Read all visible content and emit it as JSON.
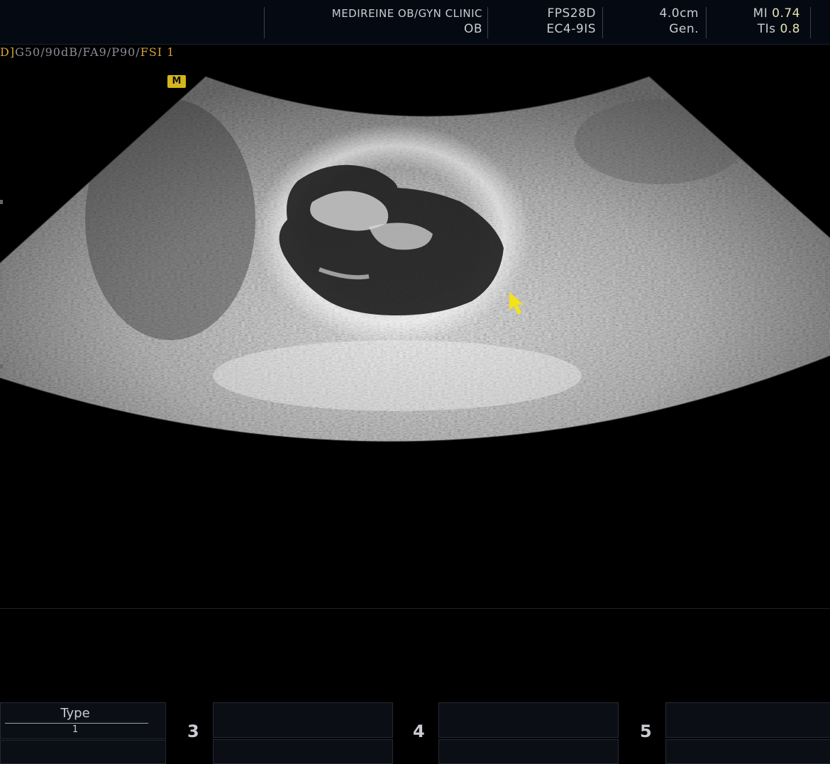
{
  "header": {
    "clinic_name": "MEDIREINE OB/GYN CLINIC",
    "application": "OB",
    "frame_rate": "FPS28D",
    "probe": "EC4-9IS",
    "depth": "4.0cm",
    "mode": "Gen.",
    "mi_label": "MI",
    "mi_value": "0.74",
    "tis_label": "TIs",
    "tis_value": "0.8"
  },
  "parameters": {
    "prefix": "D]",
    "settings": "G50/90dB/FA9/P90/",
    "fsi": "FSI 1"
  },
  "marker": {
    "label": "M"
  },
  "softkeys": {
    "type_title": "Type",
    "type_value": "1",
    "key3": "3",
    "key4": "4",
    "key5": "5"
  },
  "colors": {
    "accent_yellow": "#f2e21a",
    "fsi_orange": "#d2a13a",
    "marker_yellow": "#d4b51c"
  },
  "icons": {
    "pointer": "arrow-cursor-icon"
  }
}
